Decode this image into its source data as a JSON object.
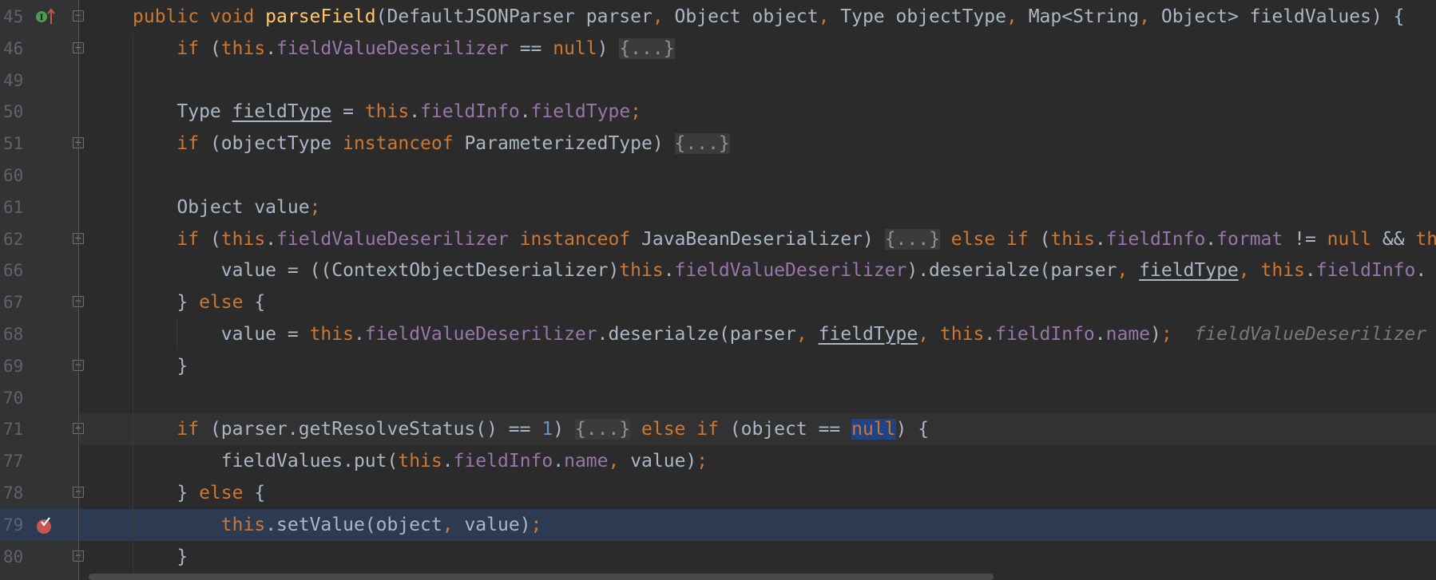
{
  "colors": {
    "background": "#2b2b2b",
    "gutter": "#313335",
    "keyword": "#cc7832",
    "method_declaration": "#ffc66d",
    "field": "#9876aa",
    "text": "#a9b7c6",
    "number": "#6897bb",
    "execution_line": "#2d3b52",
    "selection": "#214283"
  },
  "lines": [
    {
      "n": "45",
      "icons": [
        "implements-icon",
        "override-arrow-icon"
      ],
      "fold": "start",
      "tokens": [
        [
          "public void ",
          "kw"
        ],
        [
          "parseField",
          "decl"
        ],
        [
          "(DefaultJSONParser parser",
          "t"
        ],
        [
          ", ",
          "kw"
        ],
        [
          "Object object",
          "t"
        ],
        [
          ", ",
          "kw"
        ],
        [
          "Type objectType",
          "t"
        ],
        [
          ", ",
          "kw"
        ],
        [
          "Map<String",
          "t"
        ],
        [
          ", ",
          "kw"
        ],
        [
          "Object> fieldValues) {",
          "t"
        ]
      ],
      "indent": 0
    },
    {
      "n": "46",
      "fold": "plus",
      "indent": 4,
      "tokens": [
        [
          "if ",
          "kw"
        ],
        [
          "(",
          "t"
        ],
        [
          "this",
          "kw"
        ],
        [
          ".",
          "t"
        ],
        [
          "fieldValueDeserilizer",
          "f"
        ],
        [
          " == ",
          "t"
        ],
        [
          "null",
          "kw"
        ],
        [
          ") ",
          "t"
        ],
        [
          "{...}",
          "fp"
        ]
      ]
    },
    {
      "n": "49",
      "indent": 0,
      "tokens": []
    },
    {
      "n": "50",
      "indent": 4,
      "tokens": [
        [
          "Type ",
          "t"
        ],
        [
          "fieldType",
          "t u"
        ],
        [
          " = ",
          "t"
        ],
        [
          "this",
          "kw"
        ],
        [
          ".",
          "t"
        ],
        [
          "fieldInfo",
          "f"
        ],
        [
          ".",
          "t"
        ],
        [
          "fieldType",
          "f"
        ],
        [
          ";",
          "kw"
        ]
      ]
    },
    {
      "n": "51",
      "fold": "plus",
      "indent": 4,
      "tokens": [
        [
          "if ",
          "kw"
        ],
        [
          "(objectType ",
          "t"
        ],
        [
          "instanceof ",
          "kw"
        ],
        [
          "ParameterizedType) ",
          "t"
        ],
        [
          "{...}",
          "fp"
        ]
      ]
    },
    {
      "n": "60",
      "indent": 0,
      "tokens": []
    },
    {
      "n": "61",
      "indent": 4,
      "tokens": [
        [
          "Object value",
          "t"
        ],
        [
          ";",
          "kw"
        ]
      ]
    },
    {
      "n": "62",
      "fold": "plus",
      "indent": 4,
      "tokens": [
        [
          "if ",
          "kw"
        ],
        [
          "(",
          "t"
        ],
        [
          "this",
          "kw"
        ],
        [
          ".",
          "t"
        ],
        [
          "fieldValueDeserilizer",
          "f"
        ],
        [
          " ",
          "t"
        ],
        [
          "instanceof",
          "kw"
        ],
        [
          " JavaBeanDeserializer) ",
          "t"
        ],
        [
          "{...}",
          "fp"
        ],
        [
          " else if ",
          "kw"
        ],
        [
          "(",
          "t"
        ],
        [
          "this",
          "kw"
        ],
        [
          ".",
          "t"
        ],
        [
          "fieldInfo",
          "f"
        ],
        [
          ".",
          "t"
        ],
        [
          "format",
          "f"
        ],
        [
          " != ",
          "t"
        ],
        [
          "null",
          "kw"
        ],
        [
          " && ",
          "t"
        ],
        [
          "this",
          "kw"
        ]
      ]
    },
    {
      "n": "66",
      "indent": 8,
      "tokens": [
        [
          "value = ((ContextObjectDeserializer)",
          "t"
        ],
        [
          "this",
          "kw"
        ],
        [
          ".",
          "t"
        ],
        [
          "fieldValueDeserilizer",
          "f"
        ],
        [
          ").deserialze(parser",
          "t"
        ],
        [
          ", ",
          "kw"
        ],
        [
          "fieldType",
          "t u"
        ],
        [
          ", ",
          "kw"
        ],
        [
          "this",
          "kw"
        ],
        [
          ".",
          "t"
        ],
        [
          "fieldInfo",
          "f"
        ],
        [
          ".",
          "t"
        ]
      ]
    },
    {
      "n": "67",
      "fold": "end",
      "indent": 4,
      "tokens": [
        [
          "} ",
          "t"
        ],
        [
          "else ",
          "kw"
        ],
        [
          "{",
          "t"
        ]
      ]
    },
    {
      "n": "68",
      "indent": 8,
      "tokens": [
        [
          "value = ",
          "t"
        ],
        [
          "this",
          "kw"
        ],
        [
          ".",
          "t"
        ],
        [
          "fieldValueDeserilizer",
          "f"
        ],
        [
          ".deserialze(parser",
          "t"
        ],
        [
          ", ",
          "kw"
        ],
        [
          "fieldType",
          "t u"
        ],
        [
          ", ",
          "kw"
        ],
        [
          "this",
          "kw"
        ],
        [
          ".",
          "t"
        ],
        [
          "fieldInfo",
          "f"
        ],
        [
          ".",
          "t"
        ],
        [
          "name",
          "f"
        ],
        [
          ")",
          "t"
        ],
        [
          ";",
          "kw"
        ],
        [
          "  ",
          "t"
        ],
        [
          "fieldValueDeserilizer",
          "hint"
        ]
      ]
    },
    {
      "n": "69",
      "fold": "end",
      "indent": 4,
      "tokens": [
        [
          "}",
          "t"
        ]
      ]
    },
    {
      "n": "70",
      "indent": 0,
      "tokens": []
    },
    {
      "n": "71",
      "fold": "plus",
      "current": true,
      "indent": 4,
      "tokens": [
        [
          "if ",
          "kw"
        ],
        [
          "(parser.getResolveStatus() == ",
          "t"
        ],
        [
          "1",
          "num-lit"
        ],
        [
          ") ",
          "t"
        ],
        [
          "{...}",
          "fp"
        ],
        [
          " else if ",
          "kw"
        ],
        [
          "(object == ",
          "t"
        ],
        [
          "null",
          "kw sel"
        ],
        [
          ") {",
          "t"
        ]
      ]
    },
    {
      "n": "77",
      "indent": 8,
      "tokens": [
        [
          "fieldValues.put(",
          "t"
        ],
        [
          "this",
          "kw"
        ],
        [
          ".",
          "t"
        ],
        [
          "fieldInfo",
          "f"
        ],
        [
          ".",
          "t"
        ],
        [
          "name",
          "f"
        ],
        [
          ", ",
          "kw"
        ],
        [
          "value)",
          "t"
        ],
        [
          ";",
          "kw"
        ]
      ]
    },
    {
      "n": "78",
      "fold": "end",
      "indent": 4,
      "tokens": [
        [
          "} ",
          "t"
        ],
        [
          "else ",
          "kw"
        ],
        [
          "{",
          "t"
        ]
      ]
    },
    {
      "n": "79",
      "icons": [
        "breakpoint-verified-icon"
      ],
      "exec": true,
      "indent": 8,
      "tokens": [
        [
          "this",
          "kw"
        ],
        [
          ".setValue(object",
          "t"
        ],
        [
          ", ",
          "kw"
        ],
        [
          "value)",
          "t"
        ],
        [
          ";",
          "kw"
        ]
      ]
    },
    {
      "n": "80",
      "fold": "end",
      "indent": 4,
      "tokens": [
        [
          "}",
          "t"
        ]
      ]
    }
  ]
}
